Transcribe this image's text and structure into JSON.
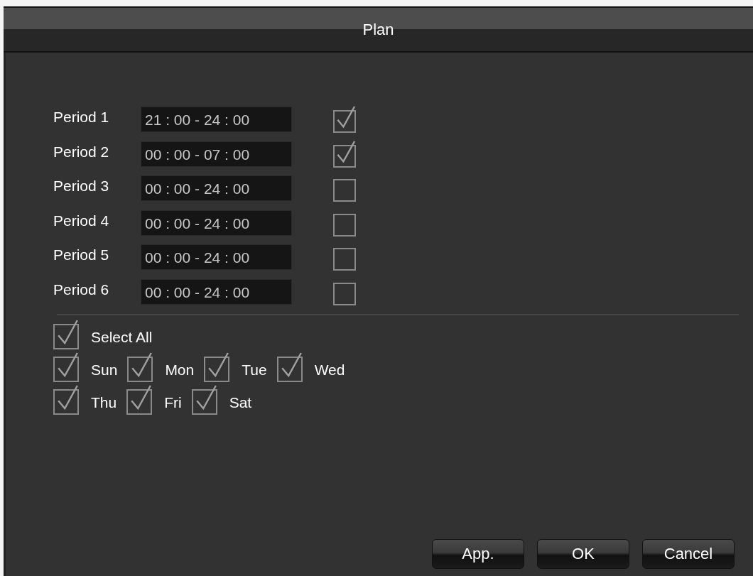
{
  "window": {
    "title": "Plan"
  },
  "periods": [
    {
      "label": "Period 1",
      "time": "21 : 00 - 24 : 00",
      "checked": true
    },
    {
      "label": "Period 2",
      "time": "00 : 00 - 07 : 00",
      "checked": true
    },
    {
      "label": "Period 3",
      "time": "00 : 00 - 24 : 00",
      "checked": false
    },
    {
      "label": "Period 4",
      "time": "00 : 00 - 24 : 00",
      "checked": false
    },
    {
      "label": "Period 5",
      "time": "00 : 00 - 24 : 00",
      "checked": false
    },
    {
      "label": "Period 6",
      "time": "00 : 00 - 24 : 00",
      "checked": false
    }
  ],
  "select_all": {
    "label": "Select All",
    "checked": true
  },
  "day_rows": [
    [
      {
        "label": "Sun",
        "checked": true
      },
      {
        "label": "Mon",
        "checked": true
      },
      {
        "label": "Tue",
        "checked": true
      },
      {
        "label": "Wed",
        "checked": true
      }
    ],
    [
      {
        "label": "Thu",
        "checked": true
      },
      {
        "label": "Fri",
        "checked": true
      },
      {
        "label": "Sat",
        "checked": true
      }
    ]
  ],
  "buttons": [
    "App.",
    "OK",
    "Cancel"
  ]
}
